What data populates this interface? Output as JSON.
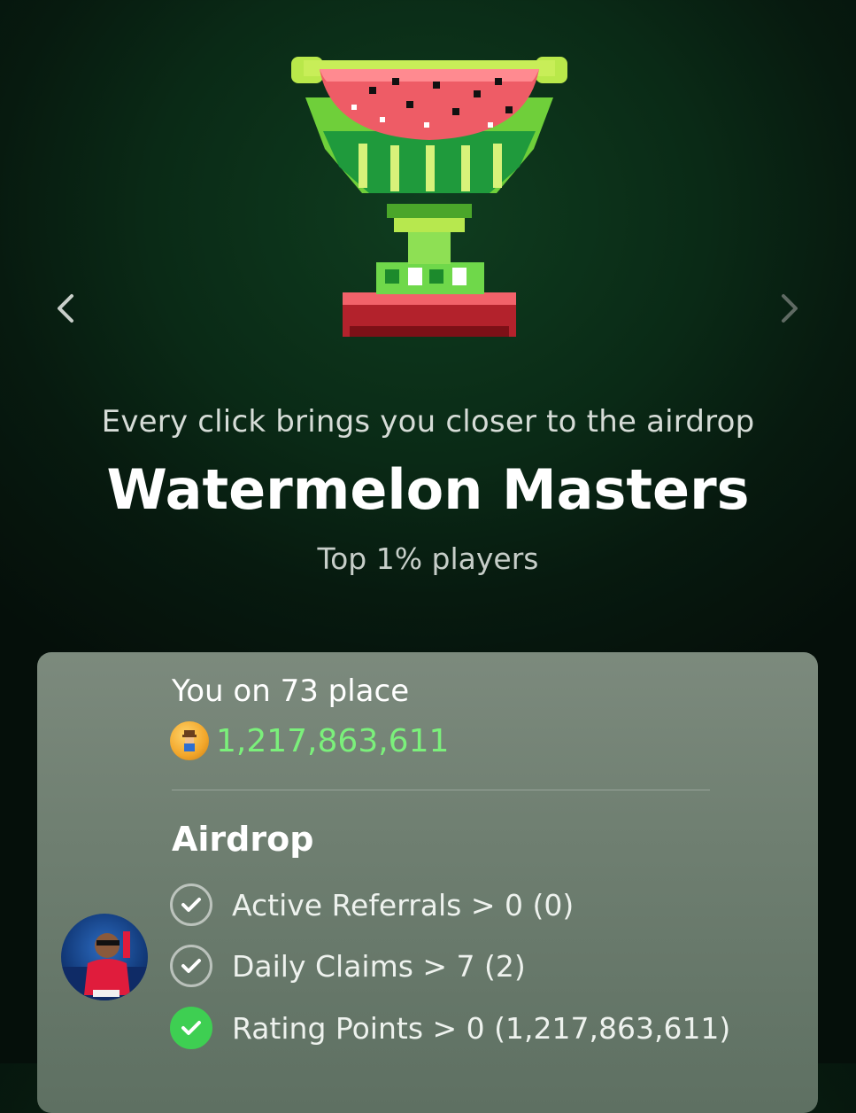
{
  "header": {
    "tagline": "Every click brings you closer to the airdrop",
    "league_title": "Watermelon Masters",
    "league_tier": "Top 1% players"
  },
  "navigation": {
    "prev_icon": "chevron-left-icon",
    "next_icon": "chevron-right-icon"
  },
  "card": {
    "place_text": "You on 73 place",
    "balance": "1,217,863,611",
    "airdrop_heading": "Airdrop",
    "requirements": [
      {
        "label": "Active Referrals > 0 (0)",
        "done": false
      },
      {
        "label": "Daily Claims > 7 (2)",
        "done": false
      },
      {
        "label": "Rating Points > 0 (1,217,863,611)",
        "done": true
      }
    ]
  },
  "colors": {
    "balance_green": "#7bf07b",
    "check_done": "#3ecf52",
    "watermelon_red": "#e8525a"
  }
}
